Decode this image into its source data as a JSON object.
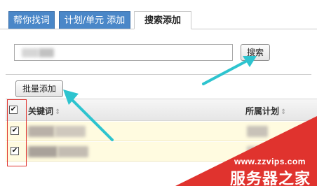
{
  "tabs": [
    {
      "label": "帮你找词",
      "active": false
    },
    {
      "label": "计划/单元 添加",
      "active": false
    },
    {
      "label": "搜索添加",
      "active": true
    }
  ],
  "search": {
    "value": "",
    "button_label": "搜索"
  },
  "bulk_add_label": "批量添加",
  "table": {
    "columns": [
      {
        "label": "关键词",
        "sort_icon": "sort-icon"
      },
      {
        "label": "所属计划",
        "sort_icon": "sort-icon"
      }
    ],
    "rows": [
      {
        "checked": true
      },
      {
        "checked": true
      }
    ],
    "header_checked": true
  },
  "watermark": {
    "url": "www.zzvips.com",
    "title": "服务器之家"
  },
  "colors": {
    "tab_blue": "#4a87c8",
    "arrow_cyan": "#2ec4cf",
    "highlight_row": "#fffbe0",
    "watermark_red": "#e0332e"
  }
}
